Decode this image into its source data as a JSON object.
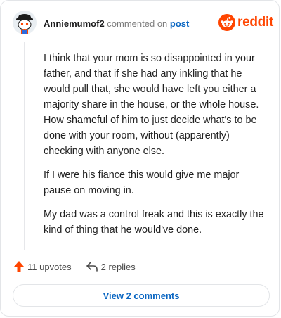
{
  "header": {
    "username": "Anniemumof2",
    "action": "commented on",
    "post_link": "post",
    "brand": "reddit"
  },
  "comment": {
    "paragraphs": [
      "I think that your mom is so disappointed in your father, and that if she had any inkling that he would pull that, she would have left you either a majority share in the house, or the whole house. How shameful of him to just decide what's to be done with your room, without (apparently) checking with anyone else.",
      "If I were his fiance this would give me major pause on moving in.",
      "My dad was a control freak and this is exactly the kind of thing that he would've done."
    ]
  },
  "footer": {
    "upvotes": "11 upvotes",
    "replies": "2 replies",
    "view_comments": "View 2 comments"
  },
  "colors": {
    "brand": "#ff4500",
    "link": "#0a66c2",
    "upvote": "#ff4500"
  },
  "icons": {
    "avatar": "snoo-avatar",
    "brand": "reddit-logo-icon",
    "upvote": "upvote-arrow-icon",
    "reply": "reply-arrow-icon"
  }
}
